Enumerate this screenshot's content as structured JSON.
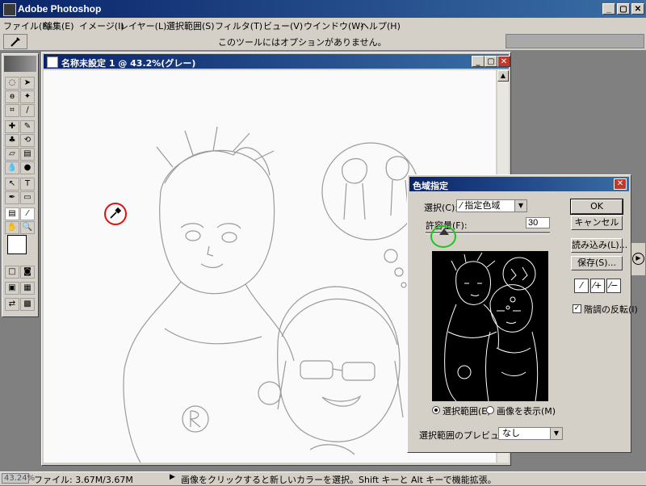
{
  "app": {
    "title": "Adobe Photoshop"
  },
  "menu": [
    "ファイル(F)",
    "編集(E)",
    "イメージ(I)",
    "レイヤー(L)",
    "選択範囲(S)",
    "フィルタ(T)",
    "ビュー(V)",
    "ウインドウ(W)",
    "ヘルプ(H)"
  ],
  "options_bar": {
    "message": "このツールにはオプションがありません。"
  },
  "document": {
    "title": "名称未設定 1 @ 43.2%(グレー)"
  },
  "dialog": {
    "title": "色域指定",
    "select_label": "選択(C):",
    "select_value": "指定色域",
    "tolerance_label": "許容量(F):",
    "tolerance_value": "30",
    "tolerance_fraction": 0.15,
    "ok_button": "OK",
    "cancel_button": "キャンセル",
    "load_button": "読み込み(L)...",
    "save_button": "保存(S)...",
    "invert_label": "階調の反転(I)",
    "invert_checked": true,
    "radio_selection": "選択範囲(E)",
    "radio_image": "画像を表示(M)",
    "preview_label": "選択範囲のプレビュー(T):",
    "preview_value": "なし"
  },
  "status": {
    "zoom": "43.24%",
    "filesize": "ファイル: 3.67M/3.67M",
    "hint": "画像をクリックすると新しいカラーを選択。Shift キーと Alt キーで機能拡張。"
  },
  "colors": {
    "title_bar": "#0a246a",
    "highlight_circle": "#e01010",
    "tolerance_circle": "#1ec41e"
  }
}
